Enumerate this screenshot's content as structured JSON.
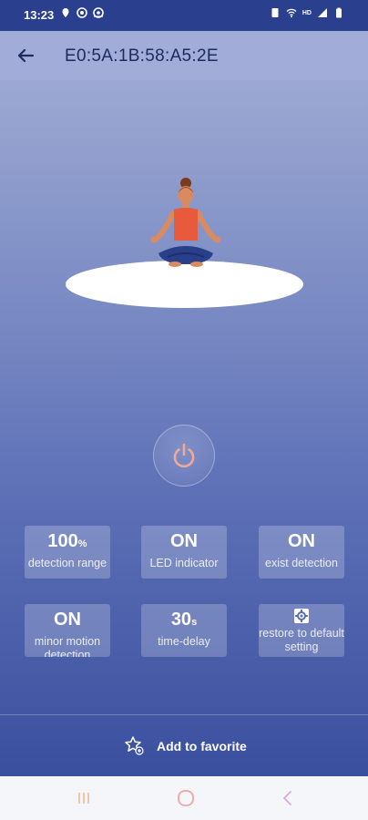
{
  "status_bar": {
    "time": "13:23",
    "left_icons": [
      "location-icon",
      "target-icon",
      "chrome-icon"
    ],
    "right_icons": [
      "sim-icon",
      "wifi-icon",
      "hd-icon",
      "signal-icon",
      "battery-icon"
    ],
    "network_label": "HD"
  },
  "toolbar": {
    "title": "E0:5A:1B:58:A5:2E"
  },
  "tiles": [
    {
      "value": "100",
      "unit": "%",
      "label": "detection range"
    },
    {
      "value": "ON",
      "unit": "",
      "label": "LED indicator"
    },
    {
      "value": "ON",
      "unit": "",
      "label": "exist detection"
    },
    {
      "value": "ON",
      "unit": "",
      "label": "minor motion detection"
    },
    {
      "value": "30",
      "unit": "s",
      "label": "time-delay"
    },
    {
      "value": "",
      "unit": "",
      "label": "restore to default setting"
    }
  ],
  "footer": {
    "favorite_label": "Add to favorite"
  },
  "colors": {
    "status_bar": "#2b3f8f",
    "toolbar": "#a2acd9",
    "accent_power": "#f0a89a",
    "gradient_top": "#a9b3d8",
    "gradient_bottom": "#3a4f9e"
  }
}
